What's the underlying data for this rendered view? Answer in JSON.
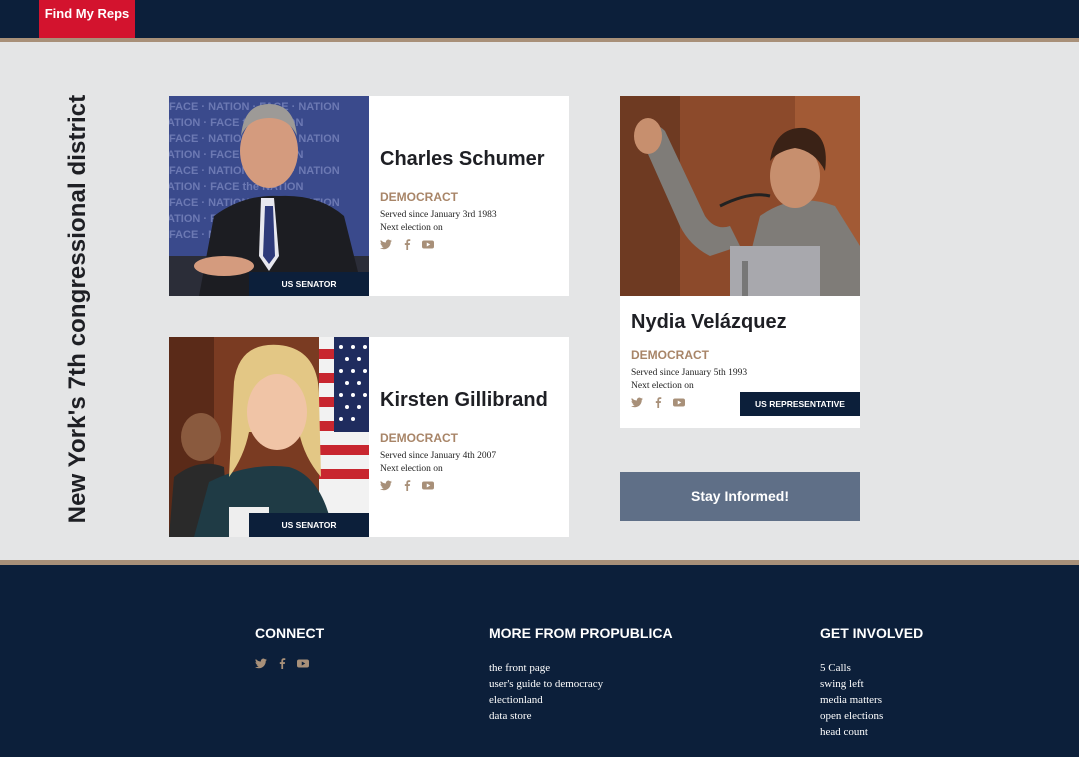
{
  "header": {
    "find_label": "Find My Reps"
  },
  "district": {
    "title": "New York's 7th congressional district"
  },
  "reps": [
    {
      "name": "Charles Schumer",
      "party": "DEMOCRACT",
      "served": "Served since January 3rd 1983",
      "next": "Next election on",
      "role": "US SENATOR"
    },
    {
      "name": "Kirsten Gillibrand",
      "party": "DEMOCRACT",
      "served": "Served since January 4th 2007",
      "next": "Next election on",
      "role": "US SENATOR"
    },
    {
      "name": "Nydia Velázquez",
      "party": "DEMOCRACT",
      "served": "Served since January 5th 1993",
      "next": "Next election on",
      "role": "US REPRESENTATIVE"
    }
  ],
  "social_icons": [
    "twitter-icon",
    "facebook-icon",
    "youtube-icon"
  ],
  "stay_informed": {
    "label": "Stay Informed!"
  },
  "footer": {
    "connect": {
      "heading": "CONNECT"
    },
    "more": {
      "heading": "MORE FROM PROPUBLICA",
      "links": [
        "the front page",
        "user's guide to democracy",
        "electionland",
        "data store"
      ]
    },
    "involved": {
      "heading": "GET INVOLVED",
      "links": [
        "5 Calls",
        "swing left",
        "media matters",
        "open elections",
        "head count"
      ]
    }
  },
  "colors": {
    "navy": "#0c1f3a",
    "red": "#d3132e",
    "tan": "#a89079",
    "party": "#a88568",
    "slate": "#5f6f87",
    "background": "#e4e5e6"
  }
}
